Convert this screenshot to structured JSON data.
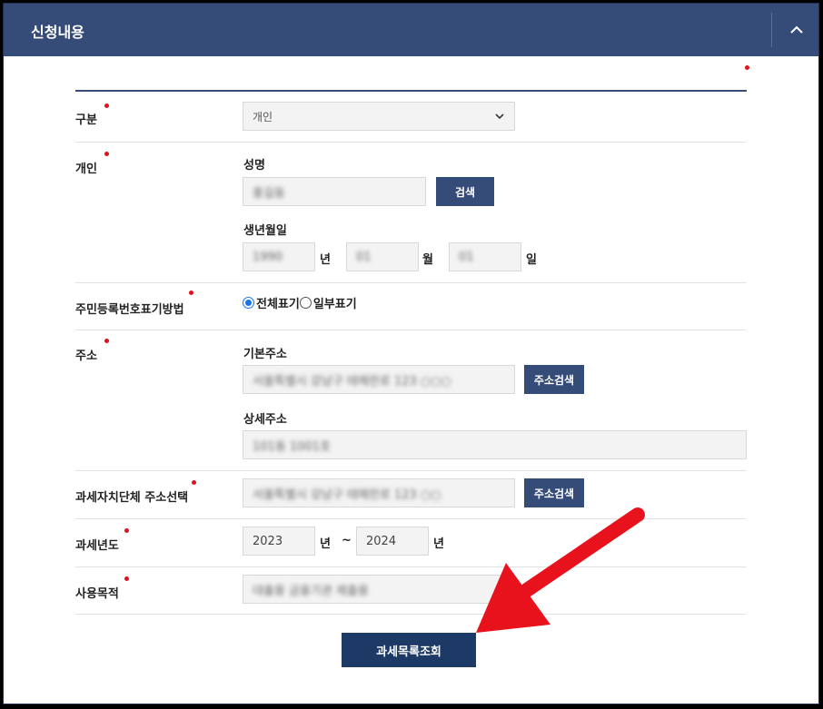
{
  "header": {
    "title": "신청내용"
  },
  "form": {
    "gubun": {
      "label": "구분",
      "selected": "개인"
    },
    "personal": {
      "label": "개인",
      "name_label": "성명",
      "name_value": "홍길동",
      "search_button": "검색",
      "birth_label": "생년월일",
      "birth_year": "1990",
      "year_unit": "년",
      "birth_month": "01",
      "month_unit": "월",
      "birth_day": "01",
      "day_unit": "일"
    },
    "rrn": {
      "label": "주민등록번호표기방법",
      "option_full": "전체표기",
      "option_partial": "일부표기"
    },
    "address": {
      "label": "주소",
      "basic_label": "기본주소",
      "basic_value": "서울특별시 강남구 테헤란로 123 ○○○",
      "search_button": "주소검색",
      "detail_label": "상세주소",
      "detail_value": "101동 1001호"
    },
    "tax_region": {
      "label": "과세자치단체 주소선택",
      "value": "서울특별시 강남구 테헤란로 123 ○○",
      "search_button": "주소검색"
    },
    "tax_year": {
      "label": "과세년도",
      "from": "2023",
      "unit_from": "년",
      "tilde": "~",
      "to": "2024",
      "unit_to": "년"
    },
    "purpose": {
      "label": "사용목적",
      "value": "대출용 금융기관 제출용"
    },
    "submit_button": "과세목록조회"
  },
  "colors": {
    "header_bg": "#354b78",
    "button_bg": "#354b78",
    "submit_bg": "#1d3a66",
    "required_dot": "#e0101d",
    "arrow": "#e8121c"
  }
}
